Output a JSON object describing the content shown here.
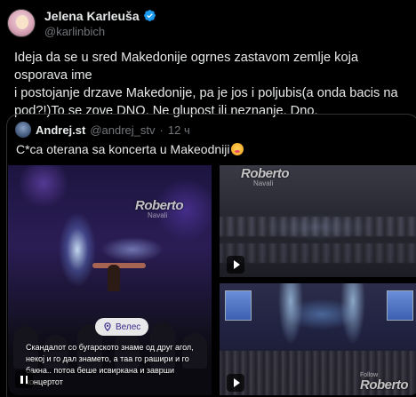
{
  "tweet": {
    "author": {
      "display_name": "Jelena Karleuša",
      "handle": "@karlinbich",
      "verified": true
    },
    "text": "Ideja da se u sred Makedonije ogrnes zastavom zemlje koja osporava ime\ni postojanje drzave Makedonije, pa je jos i poljubis(a onda bacis na\npod?!)To se zove DNO. Ne glupost ili neznanje. Dno."
  },
  "quote": {
    "author": {
      "display_name": "Andrej.st",
      "handle": "@andrej_stv",
      "separator": "·",
      "time": "12 ч"
    },
    "text": "C*ca oterana sa koncerta u Makeodniji",
    "emoji": "face-blowing-kiss",
    "media": {
      "main": {
        "watermark_top": "Roberto",
        "watermark_bottom": "Navali",
        "location": "Велес",
        "caption": "Скандалот со бугарското знаме од друг агол, некој и го дал знамето, а таа го рашири и го бакна.. потоа беше исвиркана и заврши концертот",
        "control": "pause"
      },
      "top_right": {
        "watermark_top": "Roberto",
        "watermark_bottom": "Navali",
        "control": "play"
      },
      "bottom_right": {
        "watermark_small": "Follow",
        "watermark_top": "Roberto",
        "control": "play"
      }
    }
  },
  "colors": {
    "background": "#000000",
    "text_primary": "#e7e9ea",
    "text_secondary": "#71767b",
    "verified_blue": "#1d9bf0",
    "border": "#2f3336"
  }
}
